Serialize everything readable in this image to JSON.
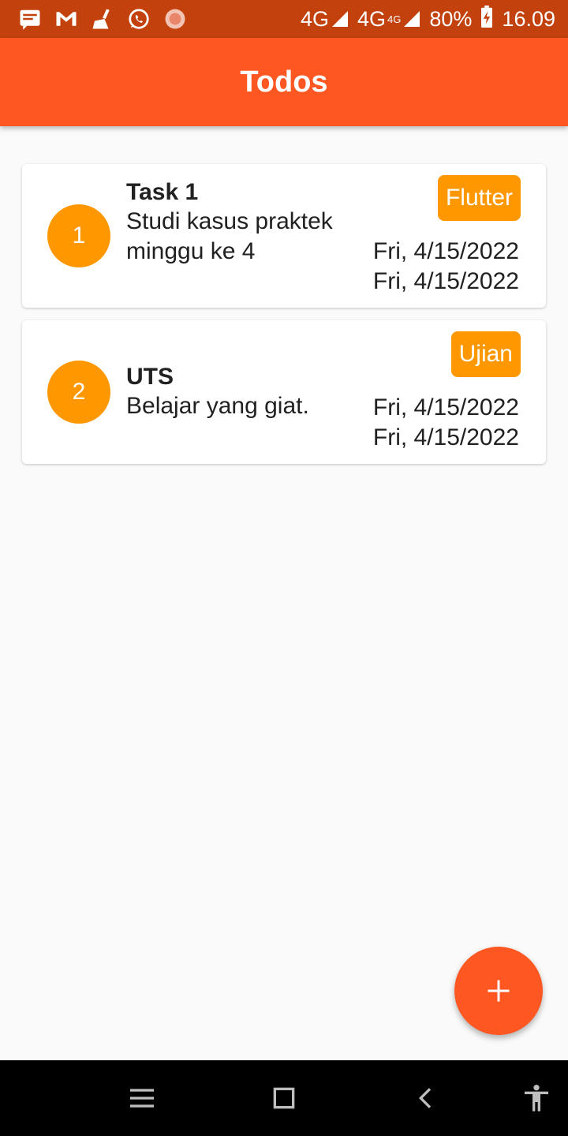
{
  "status_bar": {
    "network_1": "4G",
    "network_2": "4G",
    "network_2_sup": "4G",
    "battery": "80%",
    "time": "16.09",
    "icons": [
      "message-icon",
      "gmail-icon",
      "cleaner-icon",
      "whatsapp-icon",
      "app-icon"
    ]
  },
  "app_bar": {
    "title": "Todos"
  },
  "todos": [
    {
      "index": "1",
      "title": "Task 1",
      "description": "Studi kasus praktek minggu ke 4",
      "tag": "Flutter",
      "date_start": "Fri, 4/15/2022",
      "date_end": "Fri, 4/15/2022"
    },
    {
      "index": "2",
      "title": "UTS",
      "description": "Belajar yang giat.",
      "tag": "Ujian",
      "date_start": "Fri, 4/15/2022",
      "date_end": "Fri, 4/15/2022"
    }
  ],
  "fab": {
    "icon": "add-icon"
  },
  "nav_bar": {
    "icons": [
      "menu-icon",
      "home-square-icon",
      "back-icon",
      "accessibility-icon"
    ]
  },
  "colors": {
    "status_bar": "#c2410c",
    "app_bar": "#ff5722",
    "accent": "#ff9800",
    "background": "#fafafa",
    "fab": "#ff5722"
  }
}
